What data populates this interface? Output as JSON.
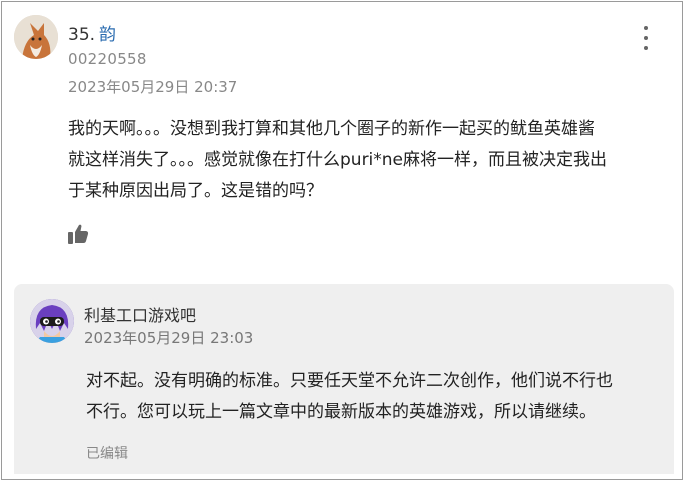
{
  "comment": {
    "number": "35.",
    "username": "韵",
    "user_id": "00220558",
    "timestamp": "2023年05月29日 20:37",
    "body_lines": [
      "我的天啊。。。没想到我打算和其他几个圈子的新作一起买的鱿鱼英雄酱",
      "就这样消失了。。。感觉就像在打什么puri*ne麻将一样，而且被决定我出",
      "于某种原因出局了。这是错的吗？"
    ],
    "avatar_icon": "fox-avatar",
    "menu_icon": "more-vertical-icon",
    "like_icon": "thumbs-up-icon"
  },
  "reply": {
    "author": "利基工口游戏吧",
    "timestamp": "2023年05月29日 23:03",
    "body_lines": [
      "对不起。没有明确的标准。只要任天堂不允许二次创作，他们说不行也",
      "不行。您可以玩上一篇文章中的最新版本的英雄游戏，所以请继续。"
    ],
    "edited_label": "已编辑",
    "avatar_icon": "inkling-avatar"
  },
  "colors": {
    "username_link": "#2b6cb0",
    "reply_background": "#efefef",
    "muted_text": "#888888"
  }
}
